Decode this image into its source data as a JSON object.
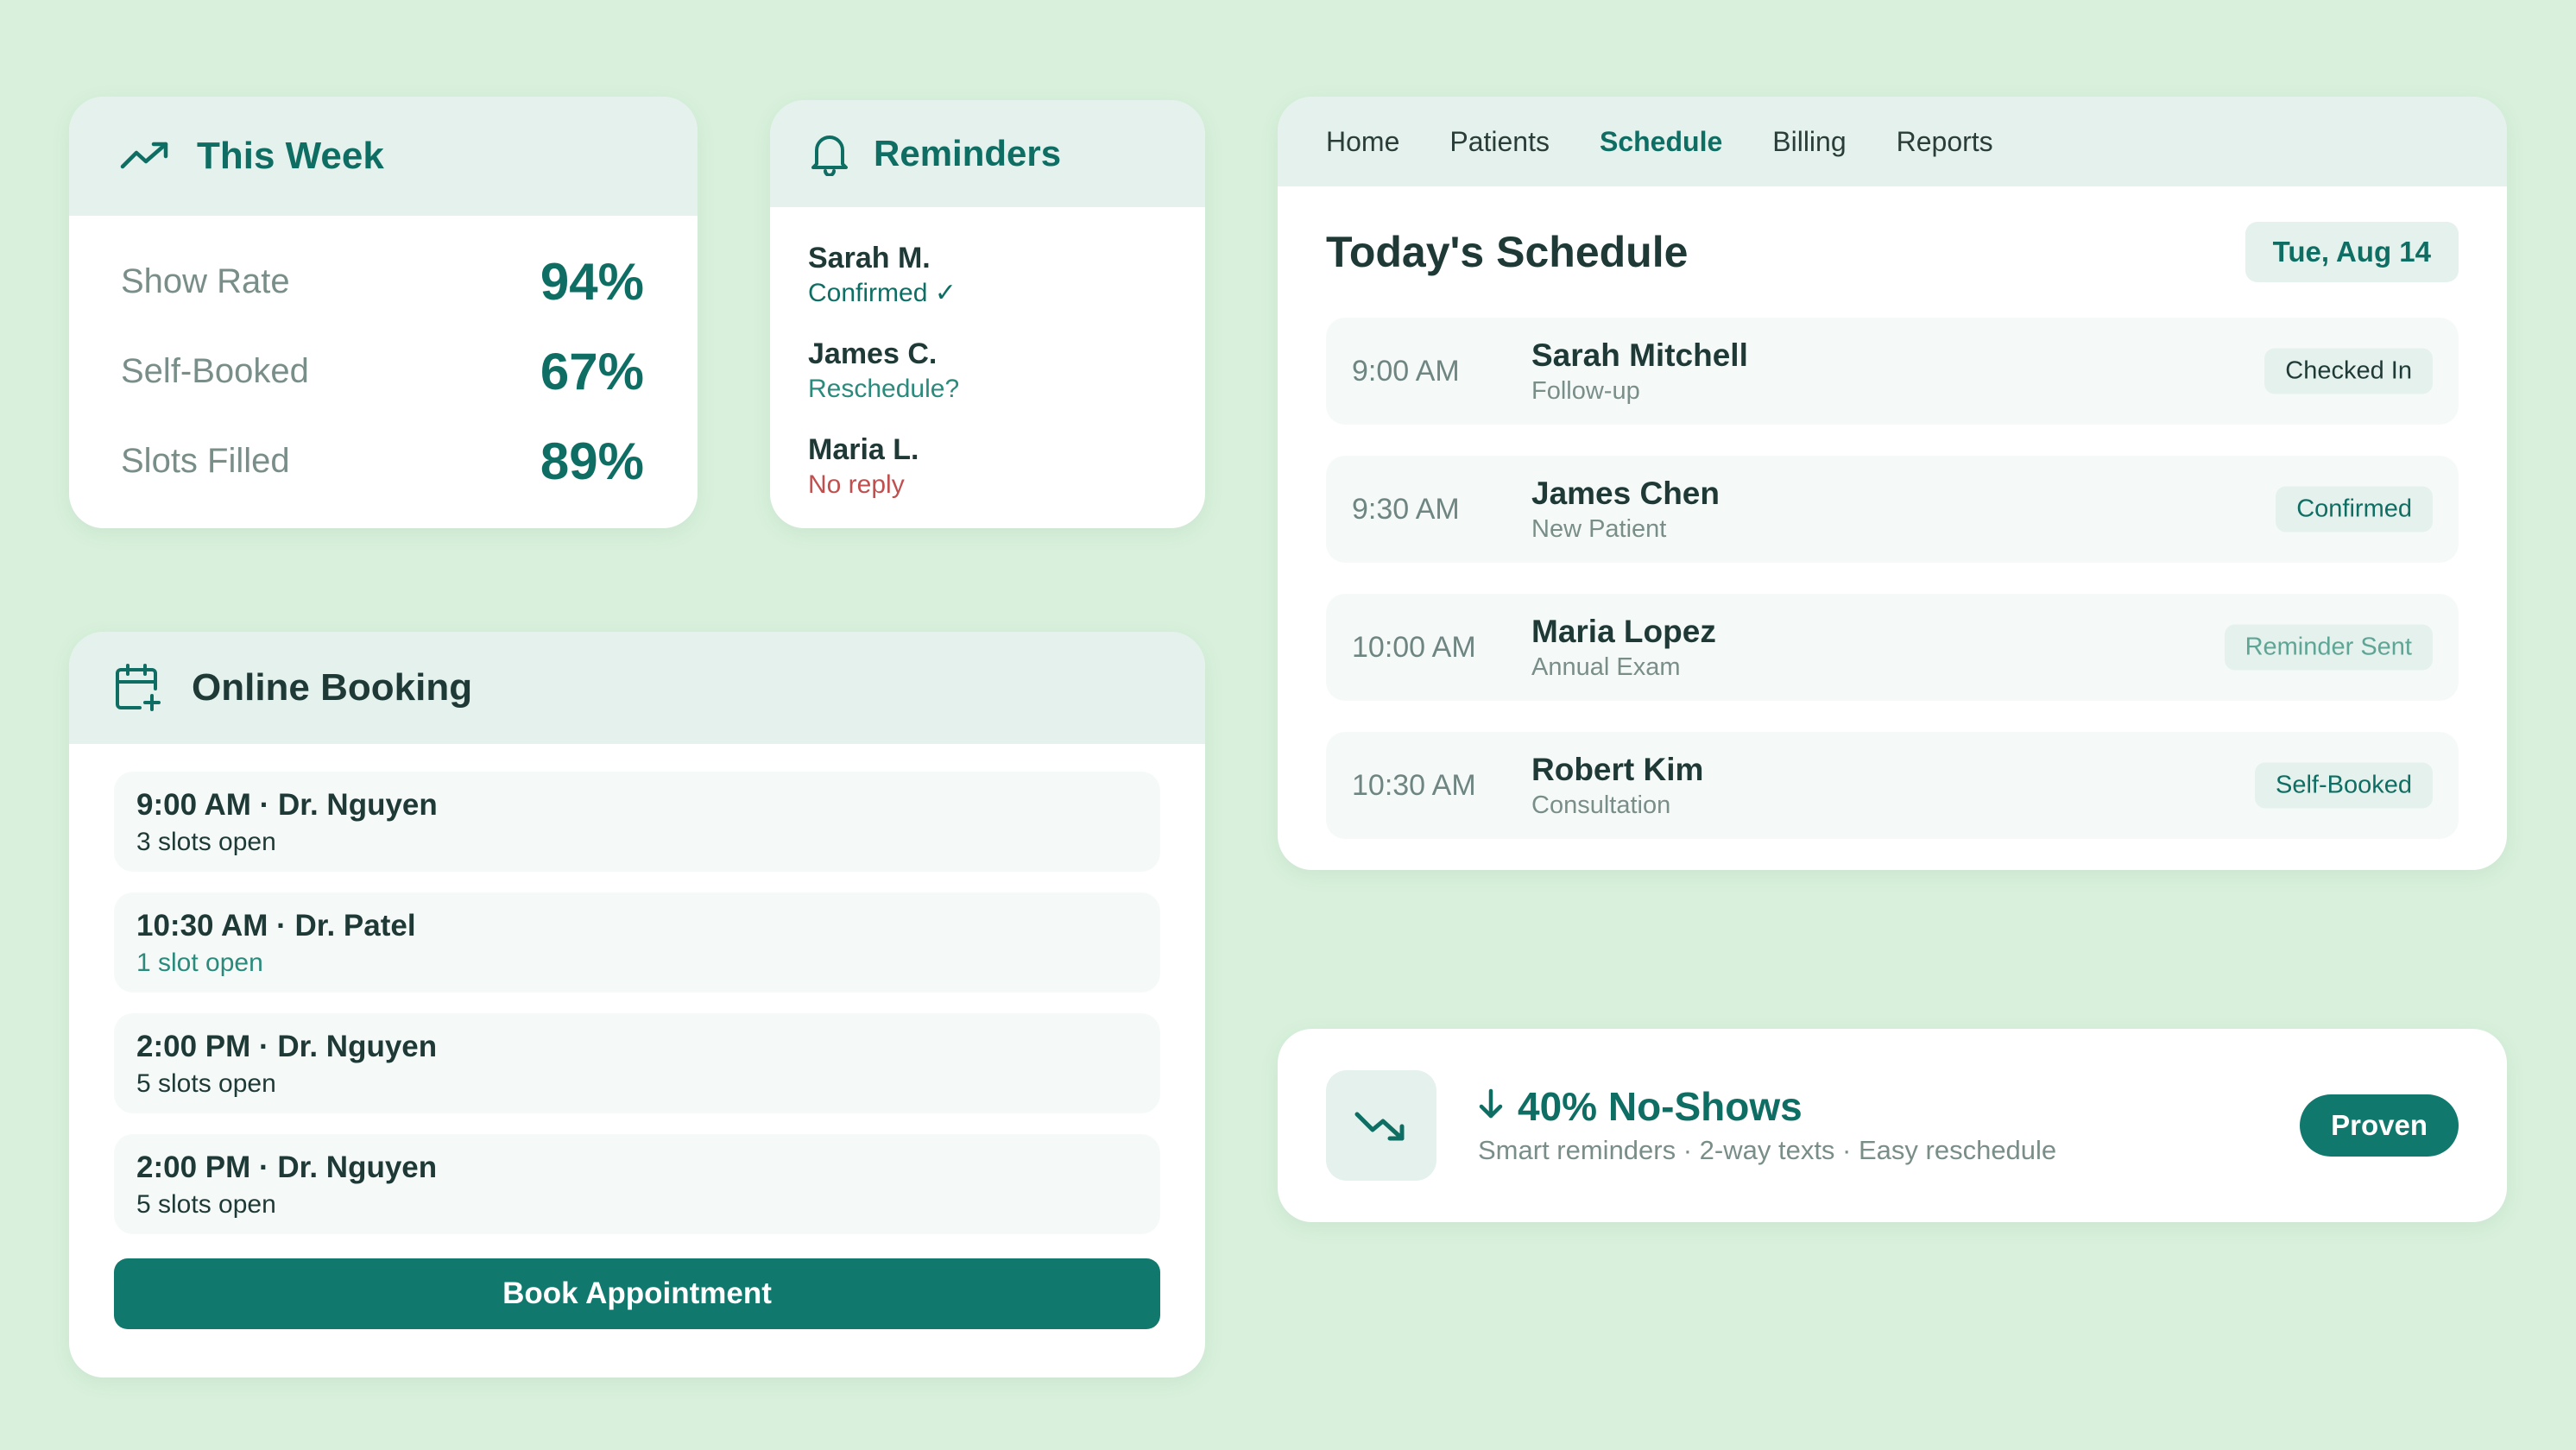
{
  "this_week": {
    "title": "This Week",
    "icon": "trending-up-icon",
    "stats": [
      {
        "label": "Show Rate",
        "value": "94%"
      },
      {
        "label": "Self-Booked",
        "value": "67%"
      },
      {
        "label": "Slots Filled",
        "value": "89%"
      }
    ]
  },
  "reminders": {
    "title": "Reminders",
    "icon": "bell-icon",
    "items": [
      {
        "name": "Sarah M.",
        "status": "Confirmed ✓"
      },
      {
        "name": "James C.",
        "status": "Reschedule?"
      },
      {
        "name": "Maria L.",
        "status": "No reply"
      }
    ]
  },
  "online_booking": {
    "title": "Online Booking",
    "icon": "calendar-plus-icon",
    "slots": [
      {
        "title": "9:00 AM · Dr. Nguyen",
        "sub": "3 slots open"
      },
      {
        "title": "10:30 AM · Dr. Patel",
        "sub": "1 slot open"
      },
      {
        "title": "2:00 PM · Dr. Nguyen",
        "sub": "5 slots open"
      },
      {
        "title": "2:00 PM · Dr. Nguyen",
        "sub": "5 slots open"
      }
    ],
    "button_label": "Book Appointment"
  },
  "schedule": {
    "nav": [
      "Home",
      "Patients",
      "Schedule",
      "Billing",
      "Reports"
    ],
    "active_nav": "Schedule",
    "title": "Today's Schedule",
    "date": "Tue, Aug 14",
    "appointments": [
      {
        "time": "9:00 AM",
        "name": "Sarah Mitchell",
        "type": "Follow-up",
        "status": "Checked In"
      },
      {
        "time": "9:30 AM",
        "name": "James Chen",
        "type": "New Patient",
        "status": "Confirmed"
      },
      {
        "time": "10:00 AM",
        "name": "Maria Lopez",
        "type": "Annual Exam",
        "status": "Reminder Sent"
      },
      {
        "time": "10:30 AM",
        "name": "Robert Kim",
        "type": "Consultation",
        "status": "Self-Booked"
      }
    ]
  },
  "no_shows": {
    "icon": "trending-down-icon",
    "arrow_icon": "arrow-down-icon",
    "title": "40% No-Shows",
    "subtitle": "Smart reminders · 2-way texts · Easy reschedule",
    "button_label": "Proven"
  },
  "colors": {
    "background": "#d9f1dc",
    "accent": "#0f6e64",
    "button": "#11786e",
    "header_tint": "#e4f1ec",
    "alert": "#c0504f"
  }
}
